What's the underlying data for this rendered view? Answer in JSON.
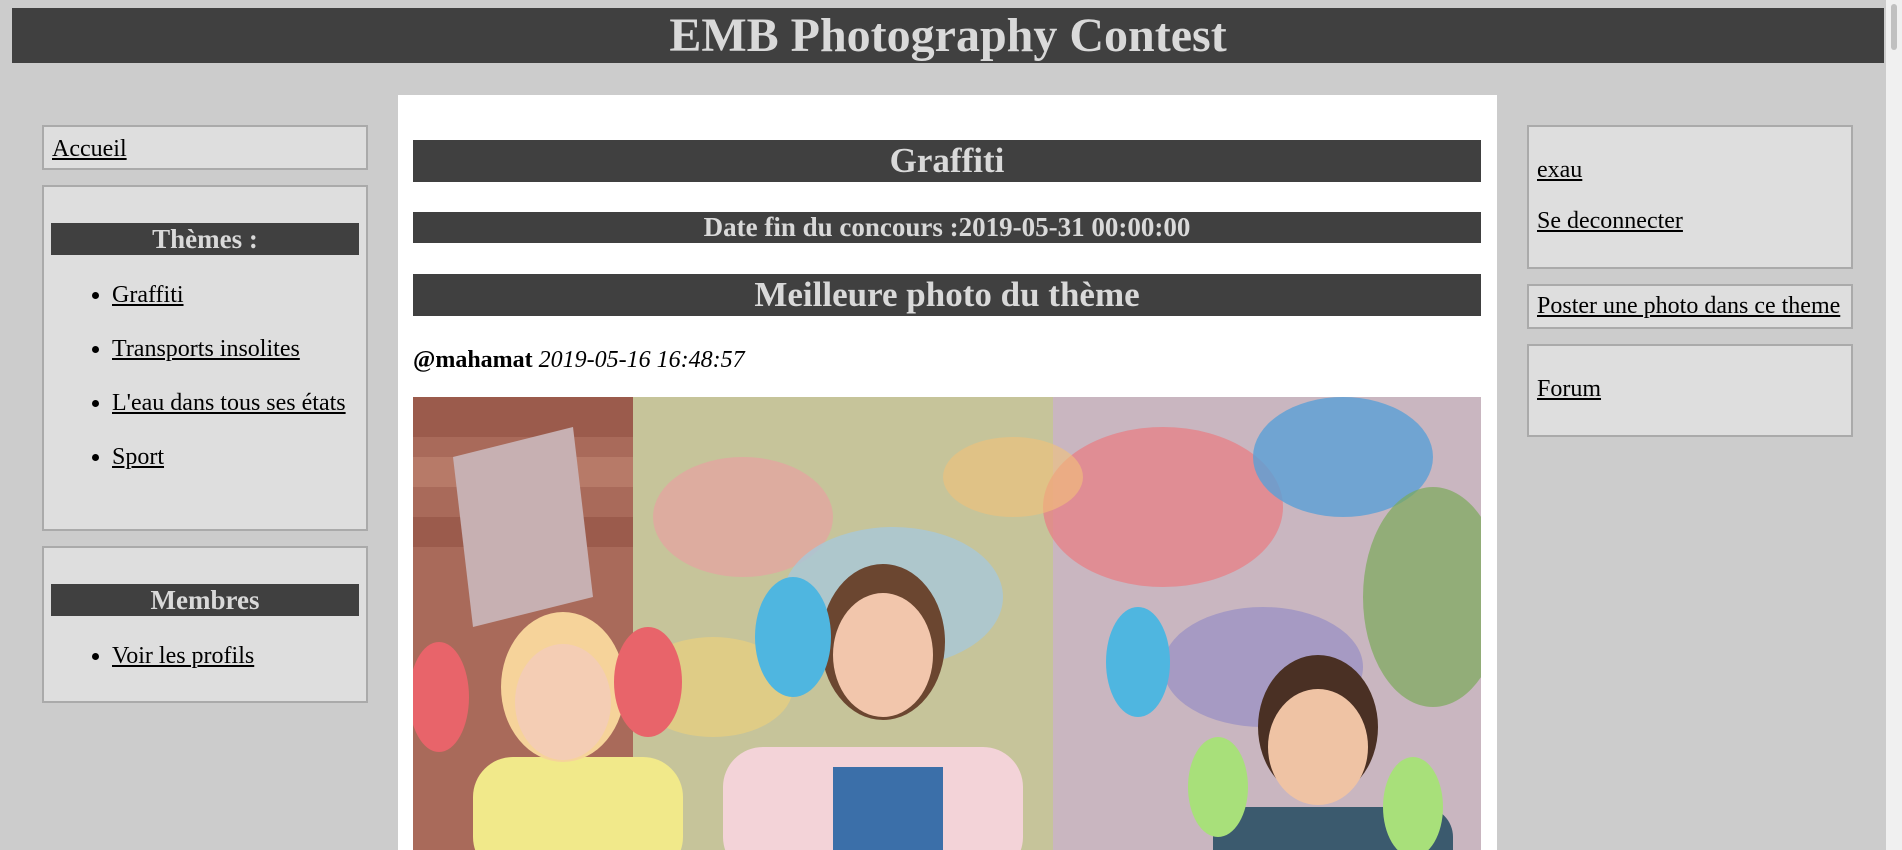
{
  "header": {
    "title": "EMB Photography Contest"
  },
  "left_nav": {
    "home_label": "Accueil",
    "themes": {
      "title": "Thèmes :",
      "items": [
        {
          "label": "Graffiti"
        },
        {
          "label": "Transports insolites"
        },
        {
          "label": "L'eau dans tous ses états"
        },
        {
          "label": "Sport"
        }
      ]
    },
    "members": {
      "title": "Membres",
      "items": [
        {
          "label": "Voir les profils"
        }
      ]
    }
  },
  "main": {
    "theme_title": "Graffiti",
    "deadline": "Date fin du concours :2019-05-31 00:00:00",
    "best_photo_title": "Meilleure photo du thème",
    "photo": {
      "author": "@mahamat",
      "date": "2019-05-16 16:48:57"
    }
  },
  "right_nav": {
    "username": "exau",
    "logout_label": "Se deconnecter",
    "post_photo_label": "Poster une photo dans ce theme",
    "forum_label": "Forum"
  },
  "colors": {
    "page_background": "#cccccc",
    "bar_background": "#404040",
    "bar_text": "#d9d9d9",
    "box_background": "#dedede",
    "box_border": "#aaaaaa",
    "content_background": "#ffffff"
  }
}
